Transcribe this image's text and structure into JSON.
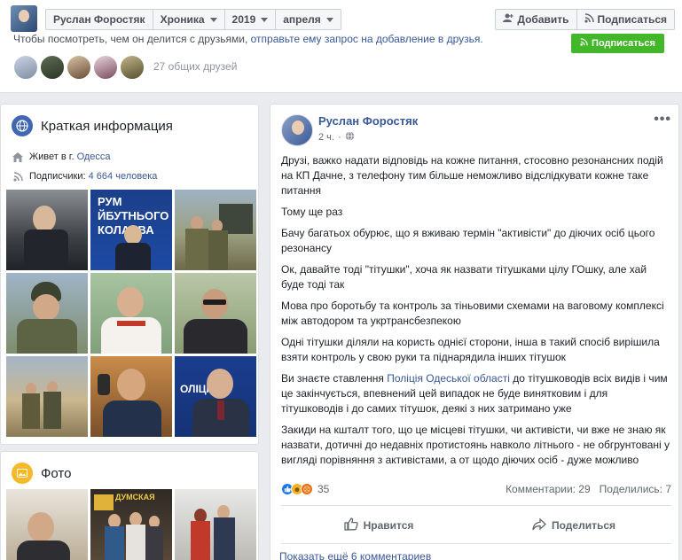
{
  "header": {
    "profile_name": "Руслан Форостяк",
    "timeline_label": "Хроника",
    "year": "2019",
    "month": "апреля",
    "add_friend_label": "Добавить",
    "follow_label": "Подписаться",
    "hint_text": "Чтобы посмотреть, чем он делится с друзьями, ",
    "hint_link": "отправьте ему запрос на добавление в друзья.",
    "subscribe_label": "Подписаться",
    "common_friends": "27 общих друзей"
  },
  "intro": {
    "title": "Краткая информация",
    "lives_in_prefix": "Живет в г. ",
    "lives_in_city": "Одесса",
    "followers_prefix": "Подписчики: ",
    "followers_count": "4 664 человека"
  },
  "photos": {
    "title": "Фото"
  },
  "post": {
    "author": "Руслан Форостяк",
    "time": "2 ч.",
    "paragraphs": [
      "Друзі, важко надати відповідь на кожне питання, стосовно резонансних подій на КП Дачне, з телефону тим більше неможливо відслідкувати кожне таке питання",
      "Тому ще раз",
      "Бачу багатьох обурює, що я вживаю термін \"активісти\" до діючих осіб цього резонансу",
      "Ок, давайте тоді \"тітушки\", хоча як назвати тітушками цілу ГОшку, але хай буде тоді так",
      "Мова про боротьбу та контроль за тіньовими схемами на ваговому комплексі між автодором та укртрансбезпекою",
      "Одні тітушки діляли на користь однієї сторони, інша в такий спосіб вирішила взяти контроль у свою руки та піднарядила інших тітушок"
    ],
    "para7_before": "Ви знаєте ставлення ",
    "para7_link": "Поліція Одеської області",
    "para7_after": " до тітушководів всіх видів і чим це закінчується, впевнений цей випадок не буде винятковим і для тітушководів і до самих тітушок, деякі з них затримано уже",
    "para8": "Закиди на кшталт того, що це місцеві тітушки, чи активісти, чи вже не знаю як назвати, дотичні до недавніх протистоянь навколо літнього - не обгрунтовані у вигляді порівняння з активістами, а от щодо діючих осіб - дуже можливо",
    "reactions_count": "35",
    "comments": "Комментарии: 29",
    "shares": "Поделились: 7",
    "like_label": "Нравится",
    "share_label": "Поделиться",
    "more_comments": "Показать ещё 6 комментариев"
  },
  "colors": {
    "brand_blue": "#4267b2",
    "link_blue": "#385898",
    "green": "#42b72a"
  }
}
